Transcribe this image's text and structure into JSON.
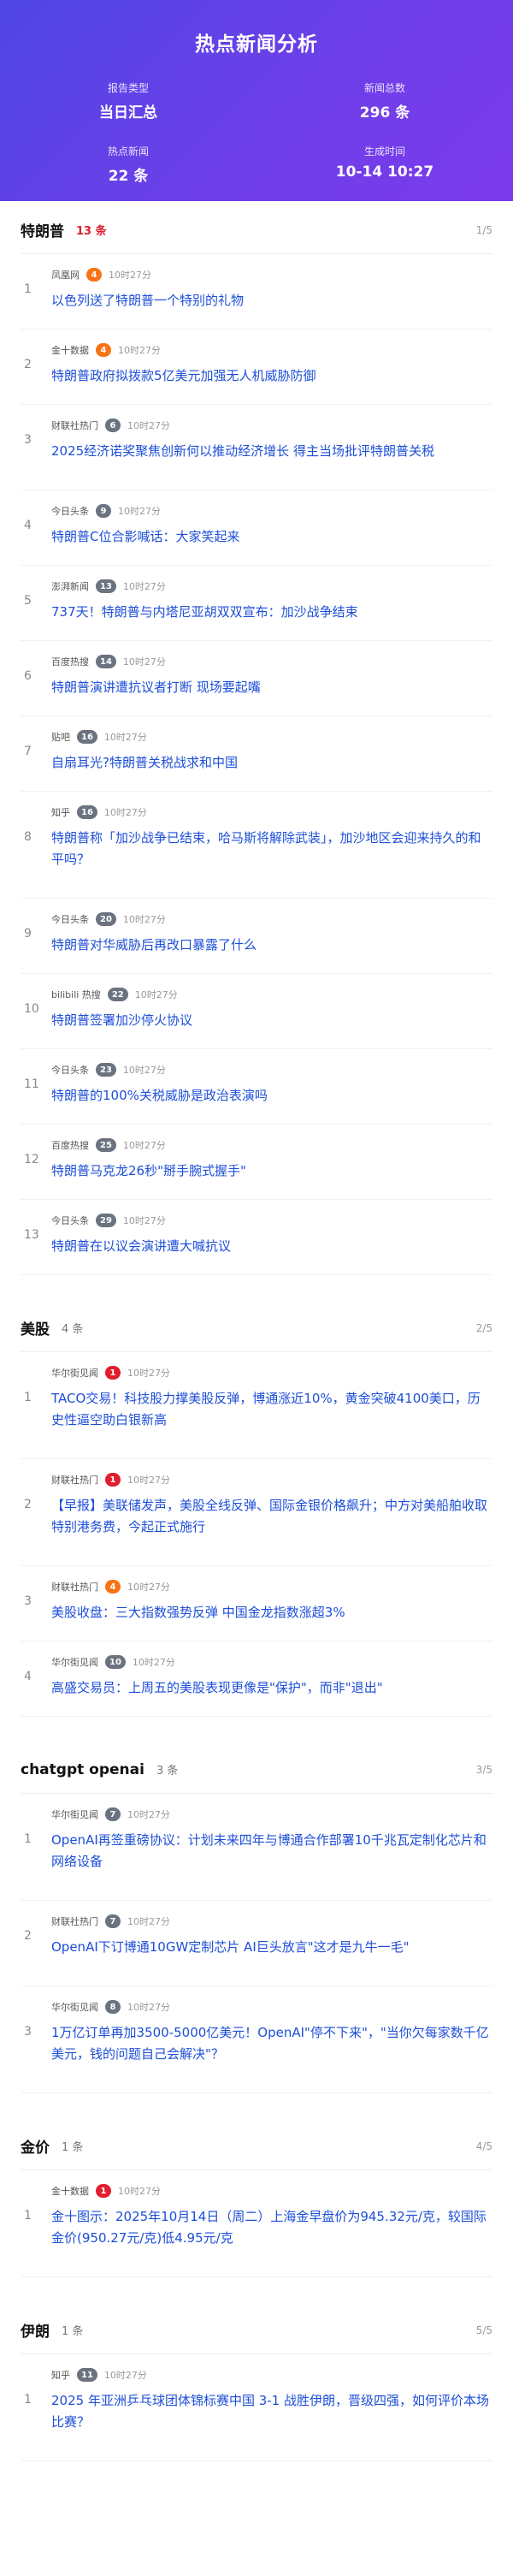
{
  "header": {
    "title": "热点新闻分析",
    "stats": [
      {
        "label": "报告类型",
        "value": "当日汇总"
      },
      {
        "label": "新闻总数",
        "value": "296 条"
      },
      {
        "label": "热点新闻",
        "value": "22 条"
      },
      {
        "label": "生成时间",
        "value": "10-14 10:27"
      }
    ]
  },
  "sections": [
    {
      "title": "特朗普",
      "count": "13 条",
      "hot": true,
      "page": "1/5",
      "items": [
        {
          "rank": "1",
          "source": "凤凰网",
          "badge": "4",
          "badge_color": "orange",
          "time": "10时27分",
          "title": "以色列送了特朗普一个特别的礼物"
        },
        {
          "rank": "2",
          "source": "金十数据",
          "badge": "4",
          "badge_color": "orange",
          "time": "10时27分",
          "title": "特朗普政府拟拨款5亿美元加强无人机威胁防御"
        },
        {
          "rank": "3",
          "source": "财联社热门",
          "badge": "6",
          "badge_color": "gray",
          "time": "10时27分",
          "title": "2025经济诺奖聚焦创新何以推动经济增长 得主当场批评特朗普关税"
        },
        {
          "rank": "4",
          "source": "今日头条",
          "badge": "9",
          "badge_color": "gray",
          "time": "10时27分",
          "title": "特朗普C位合影喊话：大家笑起来"
        },
        {
          "rank": "5",
          "source": "澎湃新闻",
          "badge": "13",
          "badge_color": "gray",
          "time": "10时27分",
          "title": "737天！特朗普与内塔尼亚胡双双宣布：加沙战争结束"
        },
        {
          "rank": "6",
          "source": "百度热搜",
          "badge": "14",
          "badge_color": "gray",
          "time": "10时27分",
          "title": "特朗普演讲遭抗议者打断 现场要起嘴"
        },
        {
          "rank": "7",
          "source": "贴吧",
          "badge": "16",
          "badge_color": "gray",
          "time": "10时27分",
          "title": "自扇耳光?特朗普关税战求和中国"
        },
        {
          "rank": "8",
          "source": "知乎",
          "badge": "16",
          "badge_color": "gray",
          "time": "10时27分",
          "title": "特朗普称「加沙战争已结束，哈马斯将解除武装」，加沙地区会迎来持久的和平吗？"
        },
        {
          "rank": "9",
          "source": "今日头条",
          "badge": "20",
          "badge_color": "gray",
          "time": "10时27分",
          "title": "特朗普对华威胁后再改口暴露了什么"
        },
        {
          "rank": "10",
          "source": "bilibili 热搜",
          "badge": "22",
          "badge_color": "gray",
          "time": "10时27分",
          "title": "特朗普签署加沙停火协议"
        },
        {
          "rank": "11",
          "source": "今日头条",
          "badge": "23",
          "badge_color": "gray",
          "time": "10时27分",
          "title": "特朗普的100%关税威胁是政治表演吗"
        },
        {
          "rank": "12",
          "source": "百度热搜",
          "badge": "25",
          "badge_color": "gray",
          "time": "10时27分",
          "title": "特朗普马克龙26秒\"掰手腕式握手\""
        },
        {
          "rank": "13",
          "source": "今日头条",
          "badge": "29",
          "badge_color": "gray",
          "time": "10时27分",
          "title": "特朗普在以议会演讲遭大喊抗议"
        }
      ]
    },
    {
      "title": "美股",
      "count": "4 条",
      "hot": false,
      "page": "2/5",
      "items": [
        {
          "rank": "1",
          "source": "华尔街见闻",
          "badge": "1",
          "badge_color": "red",
          "time": "10时27分",
          "title": "TACO交易！科技股力撑美股反弹，博通涨近10%，黄金突破4100美口，历史性逼空助白银新高"
        },
        {
          "rank": "2",
          "source": "财联社热门",
          "badge": "1",
          "badge_color": "red",
          "time": "10时27分",
          "title": "【早报】美联储发声，美股全线反弹、国际金银价格飙升；中方对美船舶收取特别港务费，今起正式施行"
        },
        {
          "rank": "3",
          "source": "财联社热门",
          "badge": "4",
          "badge_color": "orange",
          "time": "10时27分",
          "title": "美股收盘：三大指数强势反弹 中国金龙指数涨超3%"
        },
        {
          "rank": "4",
          "source": "华尔街见闻",
          "badge": "10",
          "badge_color": "gray",
          "time": "10时27分",
          "title": "高盛交易员：上周五的美股表现更像是\"保护\"，而非\"退出\""
        }
      ]
    },
    {
      "title": "chatgpt openai",
      "count": "3 条",
      "hot": false,
      "page": "3/5",
      "items": [
        {
          "rank": "1",
          "source": "华尔街见闻",
          "badge": "7",
          "badge_color": "gray",
          "time": "10时27分",
          "title": "OpenAI再签重磅协议：计划未来四年与博通合作部署10千兆瓦定制化芯片和网络设备"
        },
        {
          "rank": "2",
          "source": "财联社热门",
          "badge": "7",
          "badge_color": "gray",
          "time": "10时27分",
          "title": "OpenAI下订博通10GW定制芯片 AI巨头放言\"这才是九牛一毛\""
        },
        {
          "rank": "3",
          "source": "华尔街见闻",
          "badge": "8",
          "badge_color": "gray",
          "time": "10时27分",
          "title": "1万亿订单再加3500-5000亿美元！OpenAI\"停不下来\"，\"当你欠每家数千亿美元，钱的问题自己会解决\"？"
        }
      ]
    },
    {
      "title": "金价",
      "count": "1 条",
      "hot": false,
      "page": "4/5",
      "items": [
        {
          "rank": "1",
          "source": "金十数据",
          "badge": "1",
          "badge_color": "red",
          "time": "10时27分",
          "title": "金十图示：2025年10月14日（周二）上海金早盘价为945.32元/克，较国际金价(950.27元/克)低4.95元/克"
        }
      ]
    },
    {
      "title": "伊朗",
      "count": "1 条",
      "hot": false,
      "page": "5/5",
      "items": [
        {
          "rank": "1",
          "source": "知乎",
          "badge": "11",
          "badge_color": "gray",
          "time": "10时27分",
          "title": "2025 年亚洲乒乓球团体锦标赛中国 3-1 战胜伊朗，晋级四强，如何评价本场比赛？"
        }
      ]
    }
  ]
}
